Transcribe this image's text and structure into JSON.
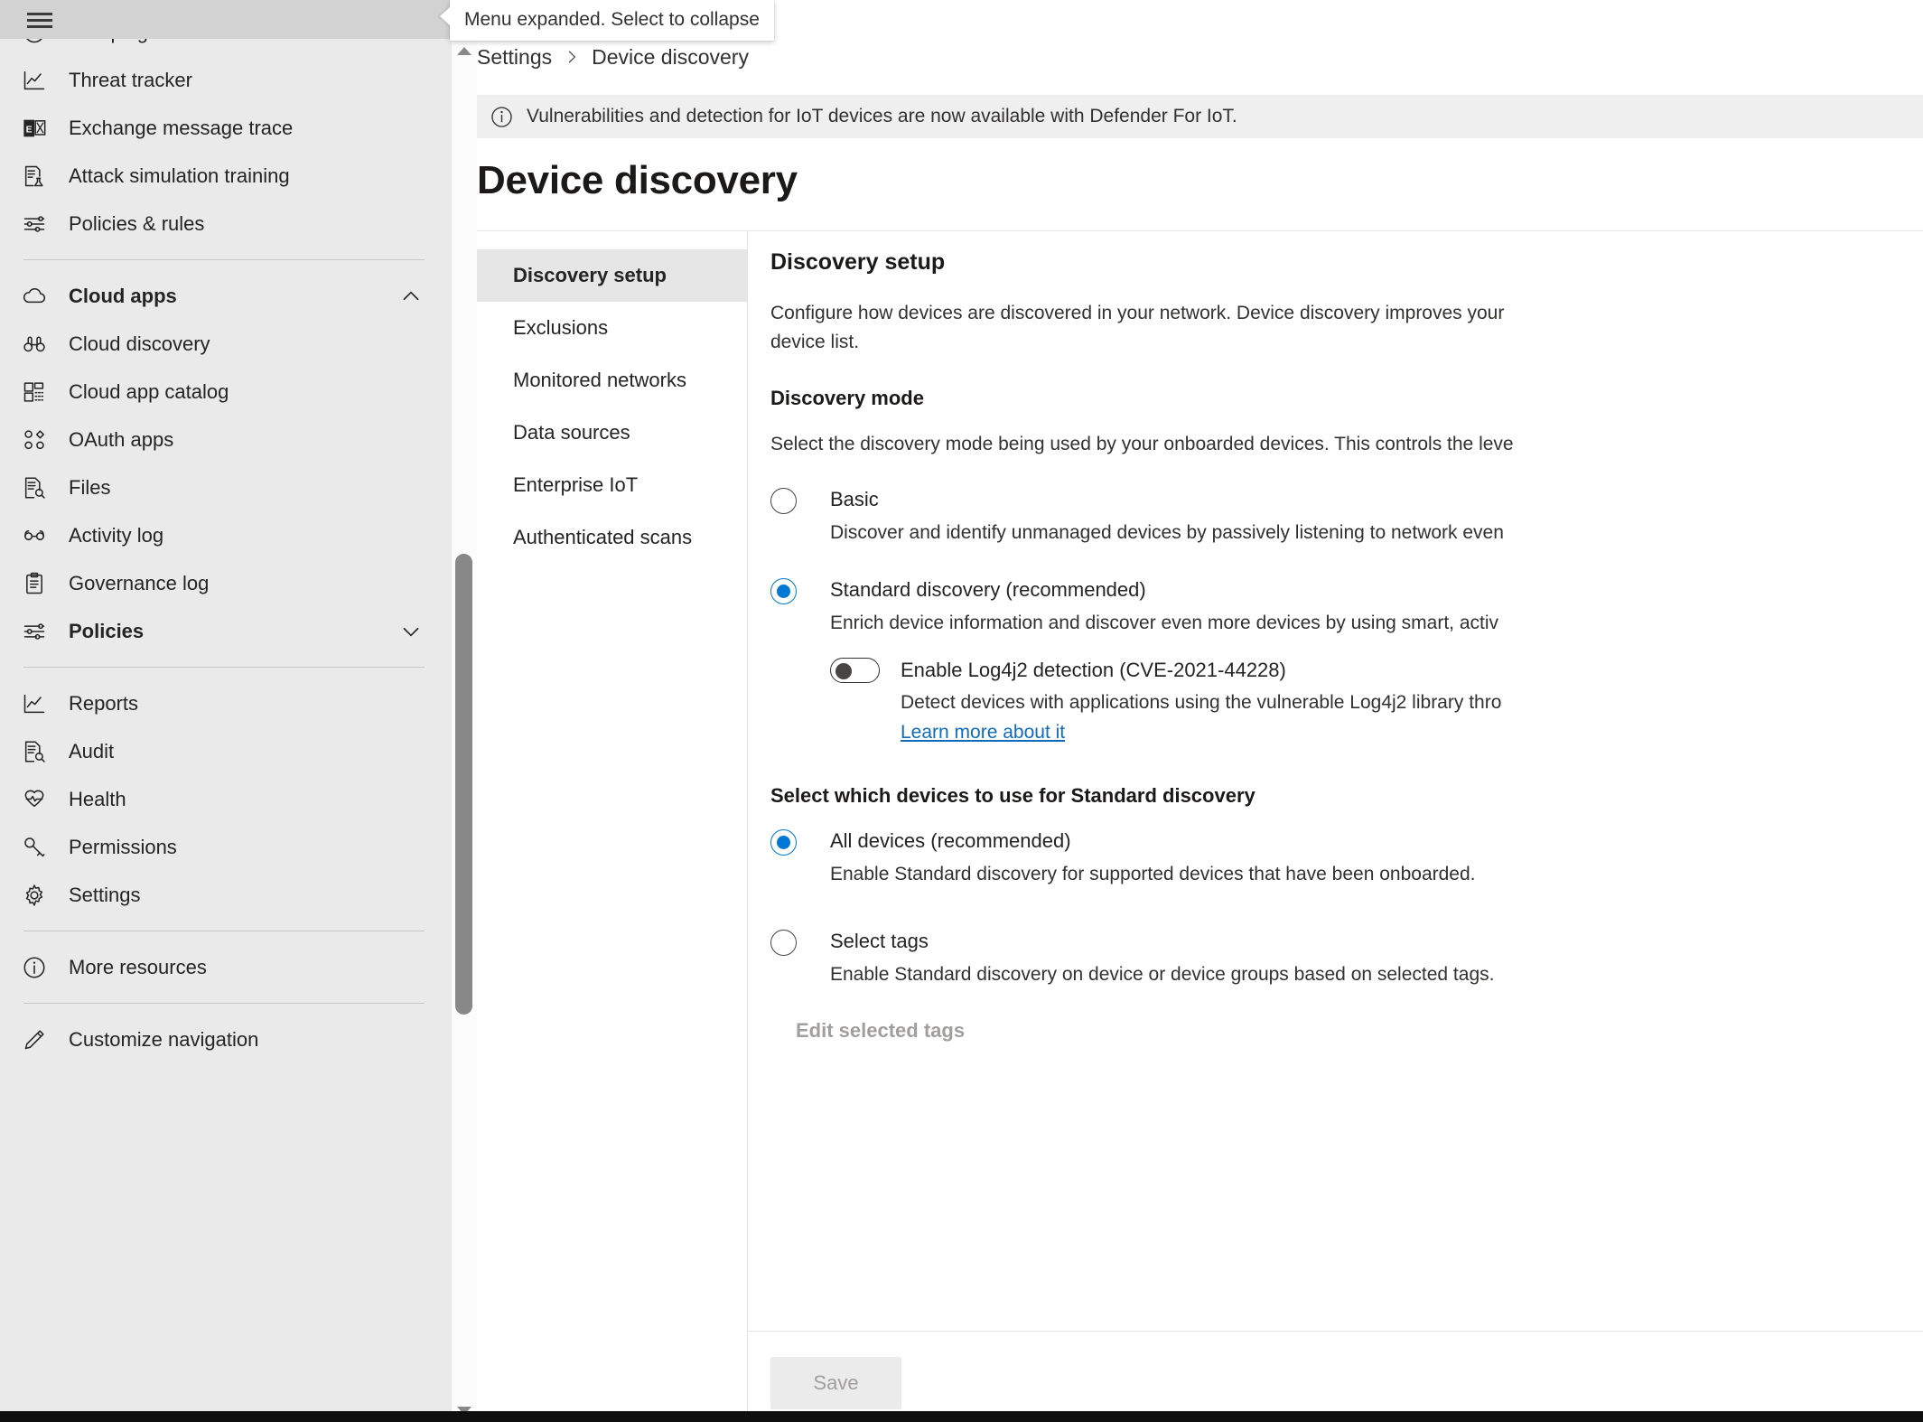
{
  "topbar": {
    "menu_button_name": "hamburger-menu",
    "tooltip": "Menu expanded. Select to collapse"
  },
  "sidebar": {
    "items": [
      {
        "label": "Campaigns",
        "icon": "target-icon",
        "type": "item"
      },
      {
        "label": "Threat tracker",
        "icon": "line-chart-icon",
        "type": "item"
      },
      {
        "label": "Exchange message trace",
        "icon": "exchange-icon",
        "type": "item"
      },
      {
        "label": "Attack simulation training",
        "icon": "flask-document-icon",
        "type": "item"
      },
      {
        "label": "Policies & rules",
        "icon": "sliders-icon",
        "type": "item"
      },
      {
        "label": "",
        "icon": "",
        "type": "separator"
      },
      {
        "label": "Cloud apps",
        "icon": "cloud-icon",
        "type": "group",
        "expanded": true,
        "chevron": "chevron-up-icon"
      },
      {
        "label": "Cloud discovery",
        "icon": "binoculars-icon",
        "type": "item"
      },
      {
        "label": "Cloud app catalog",
        "icon": "grid-list-icon",
        "type": "item"
      },
      {
        "label": "OAuth apps",
        "icon": "oauth-apps-icon",
        "type": "item"
      },
      {
        "label": "Files",
        "icon": "file-search-icon",
        "type": "item"
      },
      {
        "label": "Activity log",
        "icon": "glasses-icon",
        "type": "item"
      },
      {
        "label": "Governance log",
        "icon": "clipboard-icon",
        "type": "item"
      },
      {
        "label": "Policies",
        "icon": "sliders-icon",
        "type": "group",
        "expanded": false,
        "chevron": "chevron-down-icon"
      },
      {
        "label": "",
        "icon": "",
        "type": "separator"
      },
      {
        "label": "Reports",
        "icon": "line-chart-icon",
        "type": "item"
      },
      {
        "label": "Audit",
        "icon": "file-search-icon",
        "type": "item"
      },
      {
        "label": "Health",
        "icon": "heart-pulse-icon",
        "type": "item"
      },
      {
        "label": "Permissions",
        "icon": "key-icon",
        "type": "item"
      },
      {
        "label": "Settings",
        "icon": "gear-icon",
        "type": "item"
      },
      {
        "label": "",
        "icon": "",
        "type": "separator"
      },
      {
        "label": "More resources",
        "icon": "info-circle-icon",
        "type": "item"
      },
      {
        "label": "",
        "icon": "",
        "type": "separator"
      },
      {
        "label": "Customize navigation",
        "icon": "pencil-icon",
        "type": "item"
      }
    ]
  },
  "breadcrumb": {
    "parent": "Settings",
    "current": "Device discovery",
    "separator_icon": "chevron-right-icon"
  },
  "infobar": {
    "icon": "info-circle-icon",
    "text": "Vulnerabilities and detection for IoT devices are now available with Defender For IoT."
  },
  "page": {
    "title": "Device discovery"
  },
  "tabs": [
    {
      "label": "Discovery setup",
      "active": true
    },
    {
      "label": "Exclusions",
      "active": false
    },
    {
      "label": "Monitored networks",
      "active": false
    },
    {
      "label": "Data sources",
      "active": false
    },
    {
      "label": "Enterprise IoT",
      "active": false
    },
    {
      "label": "Authenticated scans",
      "active": false
    }
  ],
  "detail": {
    "heading": "Discovery setup",
    "intro": "Configure how devices are discovered in your network. Device discovery improves your\ndevice list.",
    "discovery_mode": {
      "title": "Discovery mode",
      "description": "Select the discovery mode being used by your onboarded devices. This controls the leve",
      "options": [
        {
          "label": "Basic",
          "description": "Discover and identify unmanaged devices by passively listening to network even",
          "selected": false
        },
        {
          "label": "Standard discovery (recommended)",
          "description": "Enrich device information and discover even more devices by using smart, activ",
          "selected": true
        }
      ],
      "log4j_toggle": {
        "label": "Enable Log4j2 detection (CVE-2021-44228)",
        "description": "Detect devices with applications using the vulnerable Log4j2 library thro",
        "link": "Learn more about it",
        "enabled": false
      }
    },
    "device_selection": {
      "title": "Select which devices to use for Standard discovery",
      "options": [
        {
          "label": "All devices (recommended)",
          "description": "Enable Standard discovery for supported devices that have been onboarded.",
          "selected": true
        },
        {
          "label": "Select tags",
          "description": "Enable Standard discovery on device or device groups based on selected tags.",
          "selected": false
        }
      ],
      "edit_tags_label": "Edit selected tags",
      "edit_tags_disabled": true
    }
  },
  "footer": {
    "save_label": "Save",
    "save_disabled": true
  },
  "colors": {
    "accent": "#0078d4",
    "link": "#0f6cbd",
    "sidebar_bg": "#eaeaea",
    "topbar_bg": "#d2d2d2",
    "infobar_bg": "#efefef",
    "tab_active_bg": "#e6e6e6",
    "disabled_text": "#a19f9d"
  }
}
